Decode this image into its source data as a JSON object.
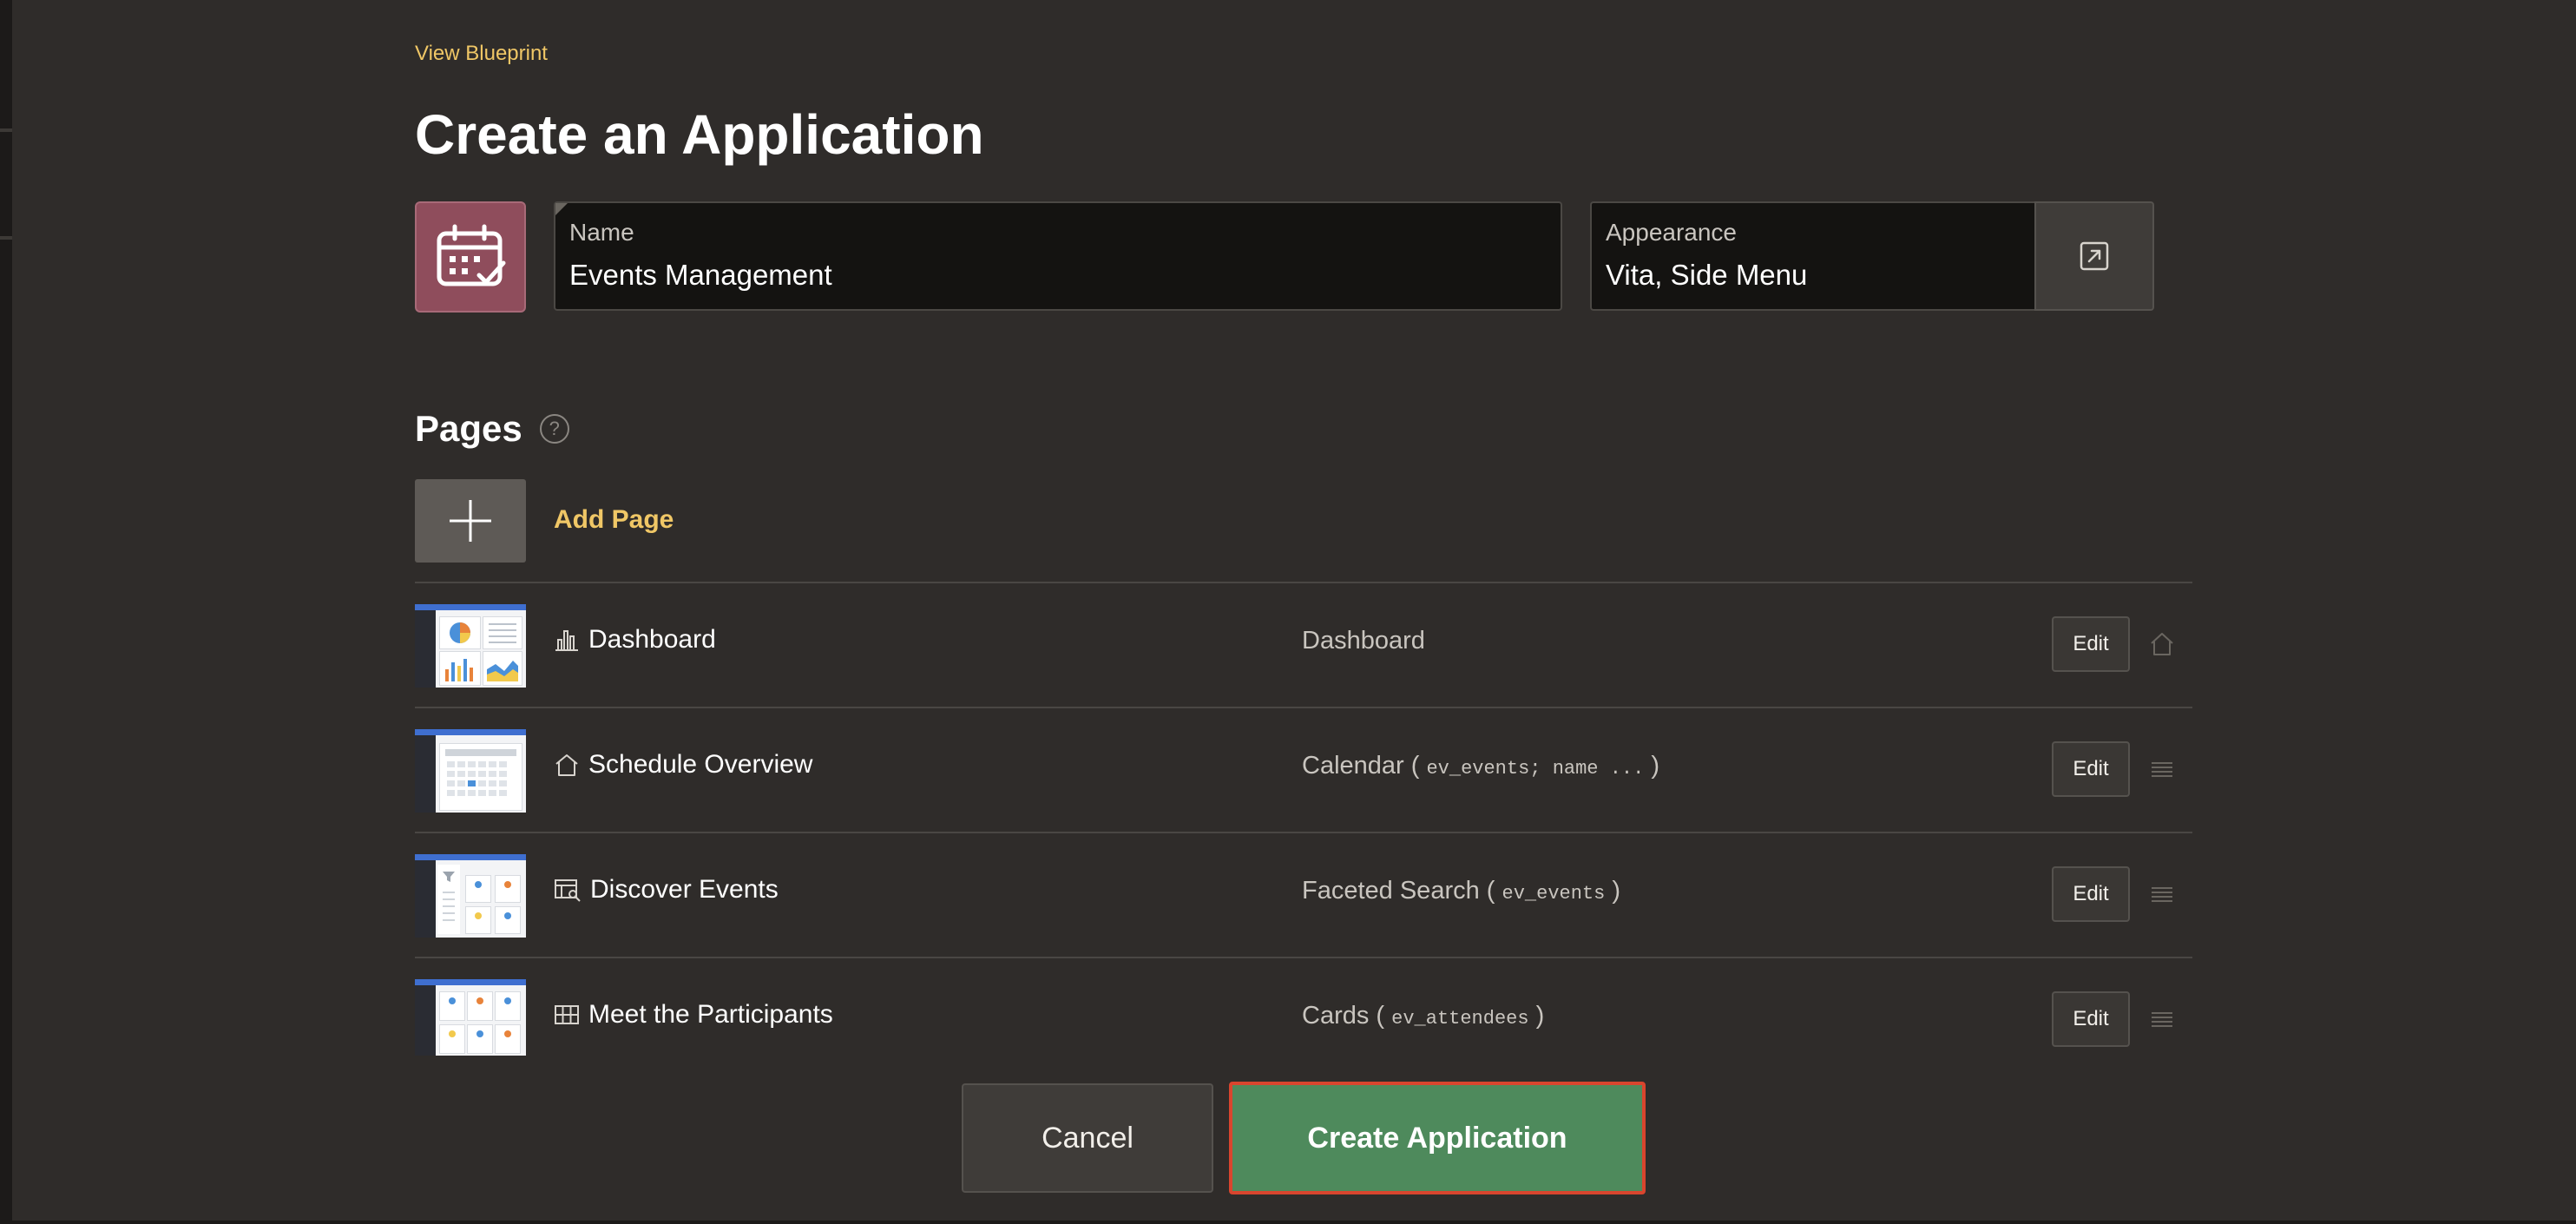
{
  "header": {
    "view_blueprint": "View Blueprint",
    "title": "Create an Application"
  },
  "app": {
    "icon": "calendar-check-icon",
    "icon_color": "#8f4d5c",
    "name_label": "Name",
    "name_value": "Events Management",
    "appearance_label": "Appearance",
    "appearance_value": "Vita, Side Menu"
  },
  "pages": {
    "title": "Pages",
    "add_label": "Add Page",
    "edit_label": "Edit",
    "items": [
      {
        "icon": "bar-chart-icon",
        "name": "Dashboard",
        "type": "Dashboard",
        "source": "",
        "end_icon": "home-icon"
      },
      {
        "icon": "home-icon",
        "name": "Schedule Overview",
        "type": "Calendar (",
        "source": "ev_events; name ...",
        "type_close": ")",
        "end_icon": "drag-handle-icon"
      },
      {
        "icon": "faceted-search-icon",
        "name": "Discover Events",
        "type": "Faceted Search (",
        "source": "ev_events",
        "type_close": ")",
        "end_icon": "drag-handle-icon"
      },
      {
        "icon": "cards-grid-icon",
        "name": "Meet the Participants",
        "type": "Cards (",
        "source": "ev_attendees",
        "type_close": ")",
        "end_icon": "drag-handle-icon"
      }
    ]
  },
  "footer": {
    "cancel": "Cancel",
    "create": "Create Application"
  },
  "colors": {
    "background": "#2f2c2a",
    "accent_link": "#f0c766",
    "primary_button": "#4e8a5c",
    "highlight_border": "#d9452e"
  }
}
